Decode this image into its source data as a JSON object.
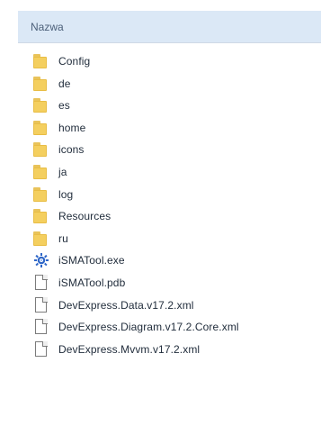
{
  "header": {
    "name_label": "Nazwa"
  },
  "items": [
    {
      "label": "Config",
      "icon": "folder-icon"
    },
    {
      "label": "de",
      "icon": "folder-icon"
    },
    {
      "label": "es",
      "icon": "folder-icon"
    },
    {
      "label": "home",
      "icon": "folder-icon"
    },
    {
      "label": "icons",
      "icon": "folder-icon"
    },
    {
      "label": "ja",
      "icon": "folder-icon"
    },
    {
      "label": "log",
      "icon": "folder-icon"
    },
    {
      "label": "Resources",
      "icon": "folder-icon"
    },
    {
      "label": "ru",
      "icon": "folder-icon"
    },
    {
      "label": "iSMATool.exe",
      "icon": "gear-app-icon"
    },
    {
      "label": "iSMATool.pdb",
      "icon": "file-icon"
    },
    {
      "label": "DevExpress.Data.v17.2.xml",
      "icon": "file-icon"
    },
    {
      "label": "DevExpress.Diagram.v17.2.Core.xml",
      "icon": "file-icon"
    },
    {
      "label": "DevExpress.Mvvm.v17.2.xml",
      "icon": "file-icon"
    }
  ],
  "colors": {
    "header_bg": "#dbe8f6",
    "folder": "#f4cf5f",
    "exe_blue": "#2f67c8"
  }
}
